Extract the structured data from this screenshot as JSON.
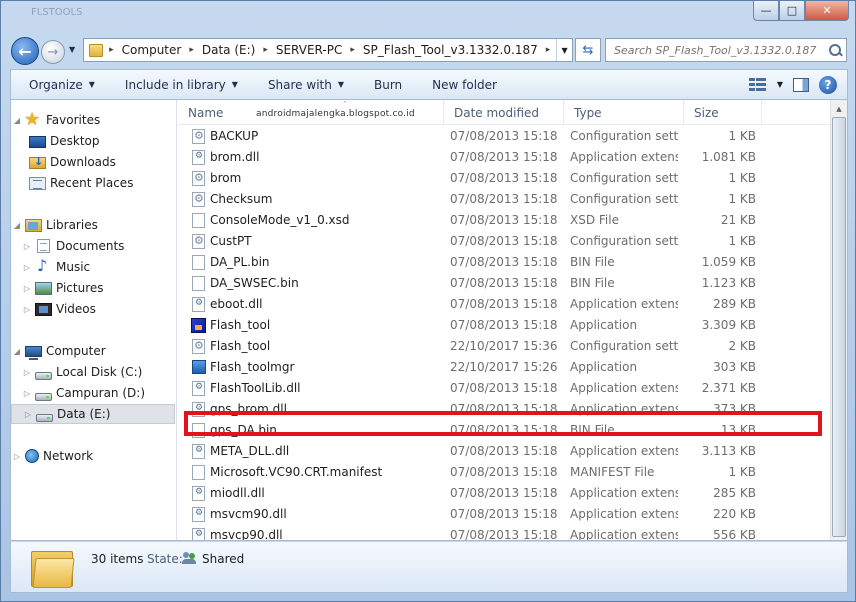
{
  "window": {
    "blurred_title": "FLSTOOLS",
    "caption": {
      "minimize": "—",
      "maximize": "□",
      "close": "✕"
    }
  },
  "address": {
    "crumbs": [
      "Computer",
      "Data (E:)",
      "SERVER-PC",
      "SP_Flash_Tool_v3.1332.0.187"
    ],
    "search_placeholder": "Search SP_Flash_Tool_v3.1332.0.187"
  },
  "toolbar": {
    "organize": "Organize",
    "include_in_library": "Include in library",
    "share_with": "Share with",
    "burn": "Burn",
    "new_folder": "New folder"
  },
  "nav": {
    "favorites": "Favorites",
    "desktop": "Desktop",
    "downloads": "Downloads",
    "recent_places": "Recent Places",
    "libraries": "Libraries",
    "documents": "Documents",
    "music": "Music",
    "pictures": "Pictures",
    "videos": "Videos",
    "computer": "Computer",
    "local_disk": "Local Disk (C:)",
    "campuran": "Campuran (D:)",
    "data_e": "Data (E:)",
    "network": "Network"
  },
  "columns": {
    "name": "Name",
    "date": "Date modified",
    "type": "Type",
    "size": "Size"
  },
  "watermark": "androidmajalengka.blogspot.co.id",
  "files": [
    {
      "name": "BACKUP",
      "date": "07/08/2013 15:18",
      "type": "Configuration sett...",
      "size": "1 KB",
      "icon": "config-icon"
    },
    {
      "name": "brom.dll",
      "date": "07/08/2013 15:18",
      "type": "Application extens...",
      "size": "1.081 KB",
      "icon": "dll-icon"
    },
    {
      "name": "brom",
      "date": "07/08/2013 15:18",
      "type": "Configuration sett...",
      "size": "1 KB",
      "icon": "config-icon"
    },
    {
      "name": "Checksum",
      "date": "07/08/2013 15:18",
      "type": "Configuration sett...",
      "size": "1 KB",
      "icon": "config-icon"
    },
    {
      "name": "ConsoleMode_v1_0.xsd",
      "date": "07/08/2013 15:18",
      "type": "XSD File",
      "size": "21 KB",
      "icon": "file-icon"
    },
    {
      "name": "CustPT",
      "date": "07/08/2013 15:18",
      "type": "Configuration sett...",
      "size": "1 KB",
      "icon": "config-icon"
    },
    {
      "name": "DA_PL.bin",
      "date": "07/08/2013 15:18",
      "type": "BIN File",
      "size": "1.059 KB",
      "icon": "file-icon"
    },
    {
      "name": "DA_SWSEC.bin",
      "date": "07/08/2013 15:18",
      "type": "BIN File",
      "size": "1.123 KB",
      "icon": "file-icon"
    },
    {
      "name": "eboot.dll",
      "date": "07/08/2013 15:18",
      "type": "Application extens...",
      "size": "289 KB",
      "icon": "dll-icon"
    },
    {
      "name": "Flash_tool",
      "date": "07/08/2013 15:18",
      "type": "Application",
      "size": "3.309 KB",
      "icon": "flash-tool-app-icon"
    },
    {
      "name": "Flash_tool",
      "date": "22/10/2017 15:36",
      "type": "Configuration sett...",
      "size": "2 KB",
      "icon": "config-icon"
    },
    {
      "name": "Flash_toolmgr",
      "date": "22/10/2017 15:26",
      "type": "Application",
      "size": "303 KB",
      "icon": "app-icon"
    },
    {
      "name": "FlashToolLib.dll",
      "date": "07/08/2013 15:18",
      "type": "Application extens...",
      "size": "2.371 KB",
      "icon": "dll-icon"
    },
    {
      "name": "gps_brom.dll",
      "date": "07/08/2013 15:18",
      "type": "Application extens...",
      "size": "373 KB",
      "icon": "dll-icon"
    },
    {
      "name": "gps_DA.bin",
      "date": "07/08/2013 15:18",
      "type": "BIN File",
      "size": "13 KB",
      "icon": "file-icon"
    },
    {
      "name": "META_DLL.dll",
      "date": "07/08/2013 15:18",
      "type": "Application extens...",
      "size": "3.113 KB",
      "icon": "dll-icon"
    },
    {
      "name": "Microsoft.VC90.CRT.manifest",
      "date": "07/08/2013 15:18",
      "type": "MANIFEST File",
      "size": "1 KB",
      "icon": "file-icon"
    },
    {
      "name": "miodll.dll",
      "date": "07/08/2013 15:18",
      "type": "Application extens...",
      "size": "285 KB",
      "icon": "dll-icon"
    },
    {
      "name": "msvcm90.dll",
      "date": "07/08/2013 15:18",
      "type": "Application extens...",
      "size": "220 KB",
      "icon": "dll-icon"
    },
    {
      "name": "msvcp90.dll",
      "date": "07/08/2013 15:18",
      "type": "Application extens...",
      "size": "556 KB",
      "icon": "dll-icon"
    }
  ],
  "highlight_color": "#e4121c",
  "details": {
    "count": "30 items",
    "state_label": "State:",
    "state_value": "Shared"
  }
}
